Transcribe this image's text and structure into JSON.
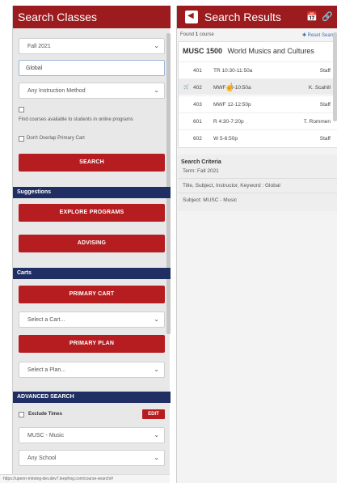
{
  "left": {
    "title": "Search Classes",
    "term_select": "Fall 2021",
    "keyword_value": "Global",
    "instruction_method": "Any Instruction Method",
    "online_checkbox_label": "Find courses available to students in online programs",
    "no_overlap_label": "Don't Overlap Primary Cart",
    "search_button": "SEARCH",
    "suggestions_label": "Suggestions",
    "explore_button": "EXPLORE PROGRAMS",
    "advising_button": "ADVISING",
    "carts_label": "Carts",
    "primary_cart_button": "PRIMARY CART",
    "select_cart": "Select a Cart...",
    "primary_plan_button": "PRIMARY PLAN",
    "select_plan": "Select a Plan...",
    "advanced_label": "ADVANCED SEARCH",
    "exclude_times_label": "Exclude Times",
    "edit_button": "EDIT",
    "subject_select": "MUSC - Music",
    "school_select": "Any School",
    "status_url": "https://upenn-minireg-dev.dev7.leepfrog.com/course-search/#"
  },
  "right": {
    "title": "Search Results",
    "found_prefix": "Found",
    "found_count": "1",
    "found_suffix": "course",
    "reset_label": "Reset Search",
    "course_code": "MUSC 1500",
    "course_name": "World Musics and Cultures",
    "sections": [
      {
        "num": "401",
        "time": "TR 10:30-11:50a",
        "instructor": "Staff",
        "in_cart": false
      },
      {
        "num": "402",
        "time": "MWF 10-10:50a",
        "instructor": "K. Scahill",
        "in_cart": true
      },
      {
        "num": "403",
        "time": "MWF 12-12:50p",
        "instructor": "Staff",
        "in_cart": false
      },
      {
        "num": "601",
        "time": "R 4:30-7:20p",
        "instructor": "T. Rommen",
        "in_cart": false
      },
      {
        "num": "602",
        "time": "W 5-6:50p",
        "instructor": "Staff",
        "in_cart": false
      }
    ],
    "criteria_title": "Search Criteria",
    "criteria_term": "Term: Fall 2021",
    "criteria_keyword": "Title, Subject, Instructor, Keyword : Global",
    "criteria_subject": "Subject: MUSC - Music"
  },
  "icons": {
    "chevron": "⌄",
    "back": "◀",
    "calendar": "📅",
    "link": "🔗",
    "cart": "🛒",
    "reset": "✱",
    "cursor": "☝"
  },
  "colors": {
    "header_red": "#9b1b1e",
    "button_red": "#b51d21",
    "section_navy": "#1f2f63",
    "link_blue": "#3a6fb0"
  }
}
